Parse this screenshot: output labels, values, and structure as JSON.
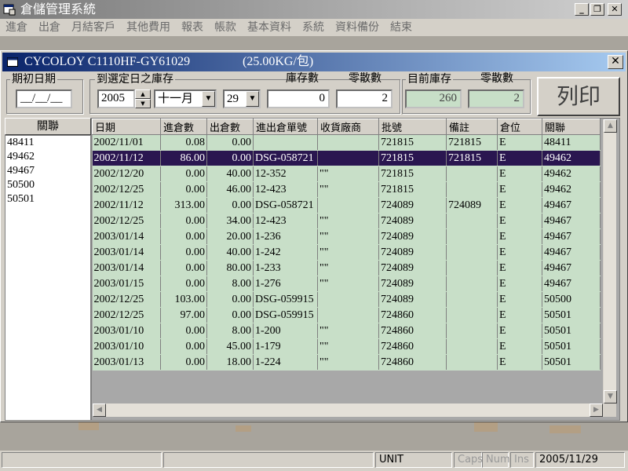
{
  "app": {
    "title": "倉儲管理系統"
  },
  "menu": [
    "進倉",
    "出倉",
    "月結客戶",
    "其他費用",
    "報表",
    "帳款",
    "基本資料",
    "系統",
    "資料備份",
    "結束"
  ],
  "child": {
    "title": "CYCOLOY C1110HF-GY61029",
    "unit_label": "(25.00KG/包)",
    "close": "✕"
  },
  "form": {
    "initial_date": {
      "label": "期初日期",
      "value": "__/__/__"
    },
    "stock_to_date": {
      "label": "到選定日之庫存",
      "year": "2005",
      "month": "十一月",
      "day": "29"
    },
    "stock_qty": {
      "label": "庫存數",
      "value": "0"
    },
    "loose_qty": {
      "label": "零散數",
      "value": "2"
    },
    "current_stock": {
      "label": "目前庫存",
      "value": "260"
    },
    "current_loose": {
      "label": "零散數",
      "value": "2"
    },
    "print_label": "列印"
  },
  "left_list": {
    "header": "關聯",
    "items": [
      "48411",
      "49462",
      "49467",
      "50500",
      "50501"
    ]
  },
  "grid": {
    "headers": [
      "日期",
      "進倉數",
      "出倉數",
      "進出倉單號",
      "收貨廠商",
      "批號",
      "備註",
      "倉位",
      "關聯"
    ],
    "selected_row": 1,
    "rows": [
      [
        "2002/11/01",
        "0.08",
        "0.00",
        "",
        "",
        "721815",
        "721815",
        "E",
        "48411"
      ],
      [
        "2002/11/12",
        "86.00",
        "0.00",
        "DSG-058721",
        "",
        "721815",
        "721815",
        "E",
        "49462"
      ],
      [
        "2002/12/20",
        "0.00",
        "40.00",
        "12-352",
        "\"\"",
        "721815",
        "",
        "E",
        "49462"
      ],
      [
        "2002/12/25",
        "0.00",
        "46.00",
        "12-423",
        "\"\"",
        "721815",
        "",
        "E",
        "49462"
      ],
      [
        "2002/11/12",
        "313.00",
        "0.00",
        "DSG-058721",
        "",
        "724089",
        "724089",
        "E",
        "49467"
      ],
      [
        "2002/12/25",
        "0.00",
        "34.00",
        "12-423",
        "\"\"",
        "724089",
        "",
        "E",
        "49467"
      ],
      [
        "2003/01/14",
        "0.00",
        "20.00",
        "1-236",
        "\"\"",
        "724089",
        "",
        "E",
        "49467"
      ],
      [
        "2003/01/14",
        "0.00",
        "40.00",
        "1-242",
        "\"\"",
        "724089",
        "",
        "E",
        "49467"
      ],
      [
        "2003/01/14",
        "0.00",
        "80.00",
        "1-233",
        "\"\"",
        "724089",
        "",
        "E",
        "49467"
      ],
      [
        "2003/01/15",
        "0.00",
        "8.00",
        "1-276",
        "\"\"",
        "724089",
        "",
        "E",
        "49467"
      ],
      [
        "2002/12/25",
        "103.00",
        "0.00",
        "DSG-059915",
        "",
        "724089",
        "",
        "E",
        "50500"
      ],
      [
        "2002/12/25",
        "97.00",
        "0.00",
        "DSG-059915",
        "",
        "724860",
        "",
        "E",
        "50501"
      ],
      [
        "2003/01/10",
        "0.00",
        "8.00",
        "1-200",
        "\"\"",
        "724860",
        "",
        "E",
        "50501"
      ],
      [
        "2003/01/10",
        "0.00",
        "45.00",
        "1-179",
        "\"\"",
        "724860",
        "",
        "E",
        "50501"
      ],
      [
        "2003/01/13",
        "0.00",
        "18.00",
        "1-224",
        "\"\"",
        "724860",
        "",
        "E",
        "50501"
      ]
    ]
  },
  "statusbar": {
    "unit": "UNIT",
    "caps": "Caps",
    "num": "Num",
    "ins": "Ins",
    "date": "2005/11/29"
  }
}
